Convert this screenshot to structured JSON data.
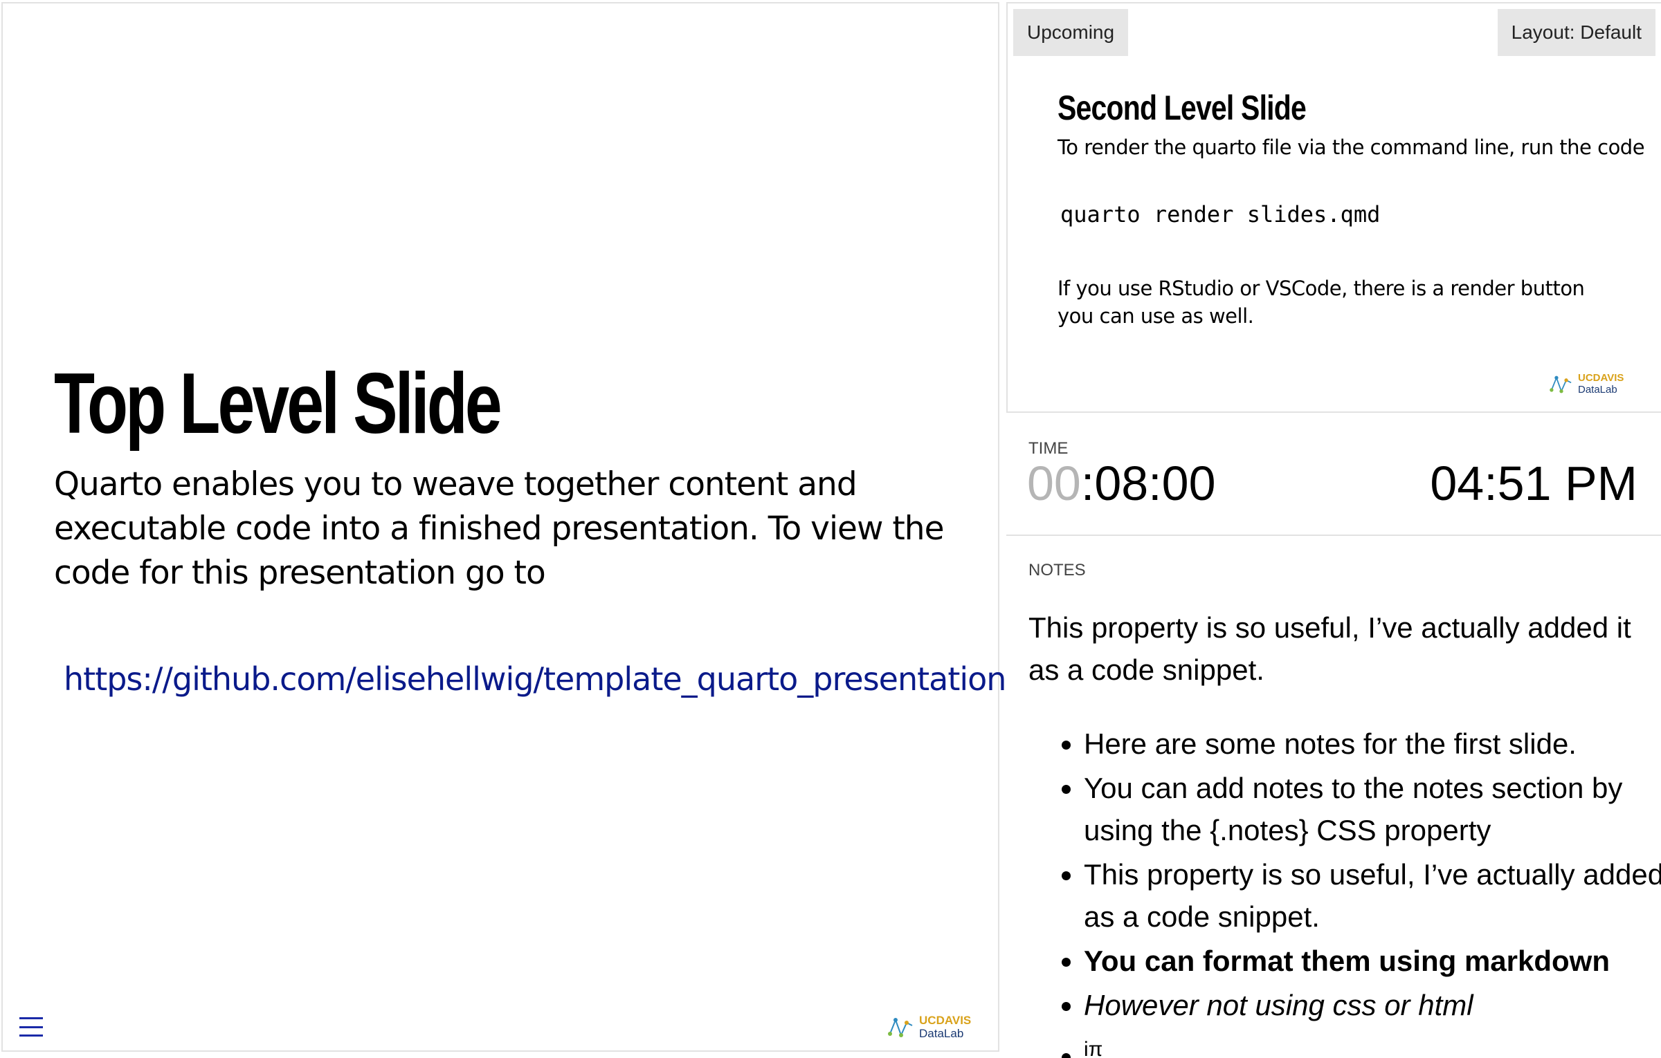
{
  "current_slide": {
    "title": "Top Level Slide",
    "body": "Quarto enables you to weave together content and executable code into a finished presentation. To view the code for this presentation go to",
    "link": "https://github.com/elisehellwig/template_quarto_presentation",
    "logo": {
      "uc": "UC",
      "davis": "DAVIS",
      "datalab": "DataLab"
    }
  },
  "upcoming": {
    "button_label": "Upcoming",
    "layout_label": "Layout: Default",
    "title": "Second Level Slide",
    "text1": "To render the quarto file via the command line, run the code",
    "code": "quarto render slides.qmd",
    "text2": "If you use RStudio or VSCode, there is a render button you can use as well.",
    "logo": {
      "uc": "UC",
      "davis": "DAVIS",
      "datalab": "DataLab"
    }
  },
  "timer": {
    "label": "TIME",
    "elapsed_dim": "00",
    "elapsed": ":08:00",
    "clock": "04:51 PM"
  },
  "notes": {
    "label": "NOTES",
    "lead": "This property is so useful, I’ve actually added it as a code snippet.",
    "items": [
      "Here are some notes for the first slide.",
      "You can add notes to the notes section by using the {.notes} CSS property",
      "This property is so useful, I’ve actually added it as a code snippet.",
      "You can format them using markdown",
      "However not using css or html"
    ],
    "partial_item_sup": "iπ"
  },
  "colors": {
    "link": "#0a1a8a",
    "menu": "#1a2aa8",
    "logo_gold": "#d9a21b",
    "logo_navy": "#1b3a73",
    "button_bg": "#e6e6e6",
    "dim_digits": "#b5b5b5"
  },
  "icons": [
    "menu-icon",
    "datalab-logo-icon"
  ]
}
